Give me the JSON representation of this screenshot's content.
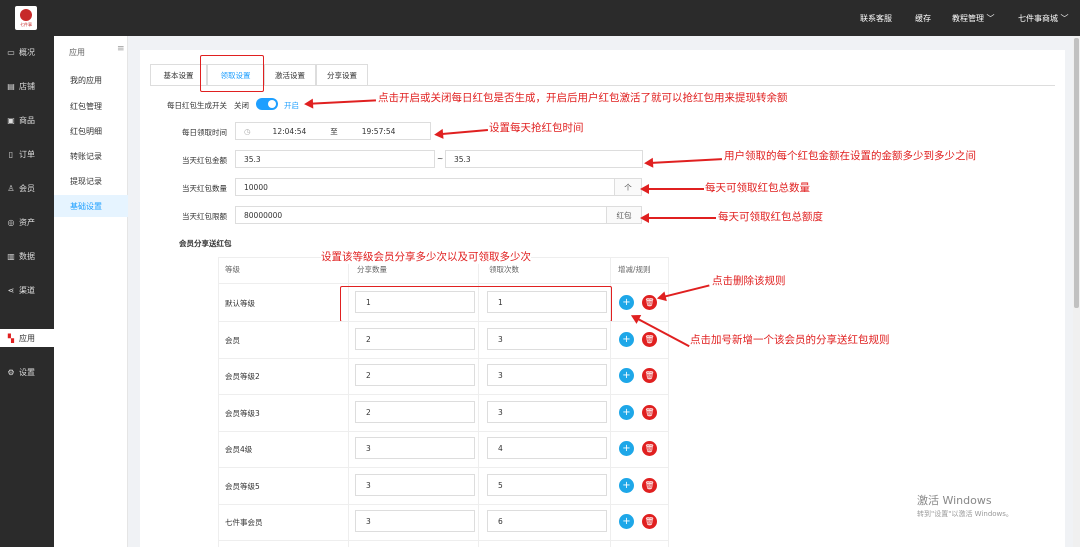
{
  "topbar": {
    "logo_text": "七件事",
    "links": [
      "联系客服",
      "缓存",
      "教程管理",
      "七件事商城"
    ]
  },
  "sidebar": {
    "items": [
      {
        "icon": "overview-icon",
        "label": "概况"
      },
      {
        "icon": "store-icon",
        "label": "店铺"
      },
      {
        "icon": "goods-icon",
        "label": "商品"
      },
      {
        "icon": "order-icon",
        "label": "订单"
      },
      {
        "icon": "member-icon",
        "label": "会员"
      },
      {
        "icon": "asset-icon",
        "label": "资产"
      },
      {
        "icon": "data-icon",
        "label": "数据"
      },
      {
        "icon": "channel-icon",
        "label": "渠道"
      },
      {
        "icon": "app-icon",
        "label": "应用"
      },
      {
        "icon": "settings-icon",
        "label": "设置"
      }
    ]
  },
  "subnav": {
    "header": "应用",
    "items": [
      "我的应用",
      "红包管理",
      "红包明细",
      "转账记录",
      "提现记录",
      "基础设置"
    ]
  },
  "tabs": [
    "基本设置",
    "领取设置",
    "激活设置",
    "分享设置"
  ],
  "form": {
    "switch_label": "每日红包生成开关",
    "switch_off": "关闭",
    "switch_on": "开启",
    "time_label": "每日领取时间",
    "time_start": "12:04:54",
    "time_sep": "至",
    "time_end": "19:57:54",
    "amount_label": "当天红包金额",
    "amount_min": "35.3",
    "amount_sep": "~",
    "amount_max": "35.3",
    "count_label": "当天红包数量",
    "count_value": "10000",
    "count_addon": "个",
    "limit_label": "当天红包限额",
    "limit_value": "80000000",
    "limit_addon": "红包"
  },
  "share": {
    "title": "会员分享送红包",
    "headers": [
      "等级",
      "分享数量",
      "领取次数",
      "增减/规则"
    ],
    "rows": [
      {
        "level": "默认等级",
        "share": "1",
        "receive": "1"
      },
      {
        "level": "会员",
        "share": "2",
        "receive": "3"
      },
      {
        "level": "会员等级2",
        "share": "2",
        "receive": "3"
      },
      {
        "level": "会员等级3",
        "share": "2",
        "receive": "3"
      },
      {
        "level": "会员4级",
        "share": "3",
        "receive": "4"
      },
      {
        "level": "会员等级5",
        "share": "3",
        "receive": "5"
      },
      {
        "level": "七件事会员",
        "share": "3",
        "receive": "6"
      }
    ]
  },
  "annotations": {
    "switch": "点击开启或关闭每日红包是否生成，开启后用户红包激活了就可以抢红包用来提现转余额",
    "time": "设置每天抢红包时间",
    "amount": "用户领取的每个红包金额在设置的金额多少到多少之间",
    "count": "每天可领取红包总数量",
    "limit": "每天可领取红包总额度",
    "share": "设置该等级会员分享多少次以及可领取多少次",
    "delete": "点击删除该规则",
    "add": "点击加号新增一个该会员的分享送红包规则"
  },
  "watermark": {
    "line1": "激活 Windows",
    "line2": "转到\"设置\"以激活 Windows。"
  },
  "colors": {
    "accent": "#1e9fff",
    "annotation": "#e02020",
    "dark": "#2b2b2b"
  }
}
